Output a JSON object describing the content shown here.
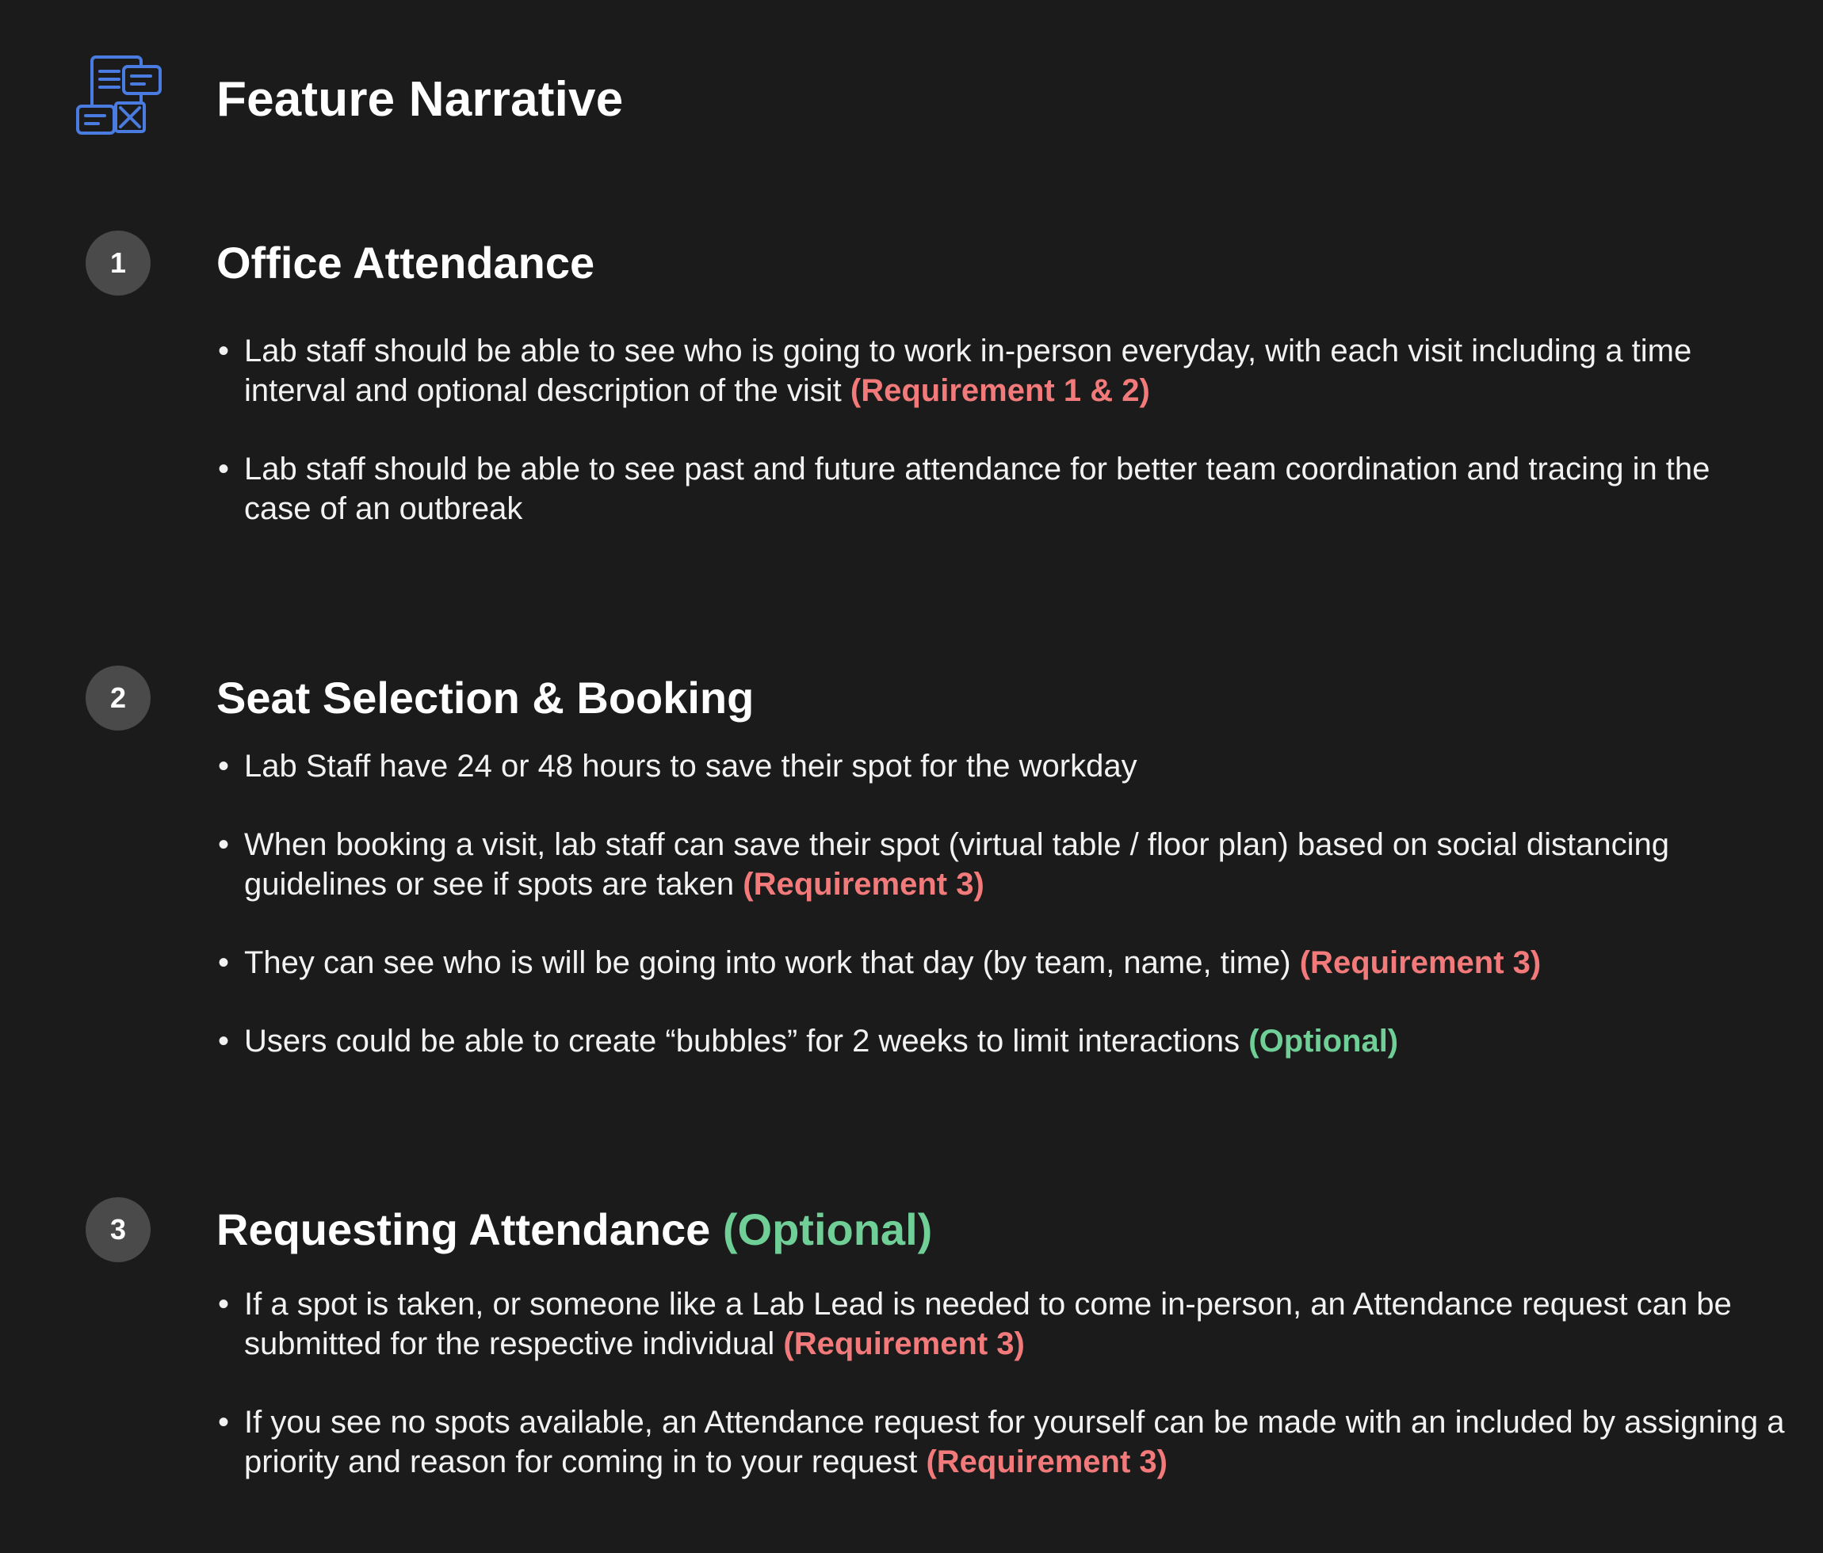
{
  "header": {
    "title": "Feature Narrative",
    "icon": "document-layout-icon",
    "icon_color": "#4a7be0"
  },
  "colors": {
    "background": "#1b1b1b",
    "badge": "#4a4a4a",
    "requirement": "#f27a7a",
    "optional": "#6fcf97"
  },
  "sections": [
    {
      "number": "1",
      "title": "Office Attendance",
      "title_tag": "",
      "bullets": [
        {
          "text": "Lab staff should be able to see who is going to work in-person everyday, with each visit including a time interval and optional description of the visit",
          "tag": "(Requirement 1 & 2)",
          "tag_type": "requirement"
        },
        {
          "text": "Lab staff should be able to see past and future attendance for better team coordination and tracing in the case of an outbreak",
          "tag": "",
          "tag_type": ""
        }
      ]
    },
    {
      "number": "2",
      "title": "Seat Selection & Booking",
      "title_tag": "",
      "bullets": [
        {
          "text": "Lab Staff have 24 or 48 hours to save their spot for the workday",
          "tag": "",
          "tag_type": ""
        },
        {
          "text": "When booking a visit, lab staff can save their spot (virtual table / floor plan) based on social distancing guidelines or see if spots are taken",
          "tag": "(Requirement 3)",
          "tag_type": "requirement"
        },
        {
          "text": "They can see who is will be going into work that day (by team, name, time)",
          "tag": "(Requirement 3)",
          "tag_type": "requirement"
        },
        {
          "text": "Users could be able to create “bubbles” for 2 weeks to limit interactions",
          "tag": "(Optional)",
          "tag_type": "optional"
        }
      ]
    },
    {
      "number": "3",
      "title": "Requesting Attendance",
      "title_tag": "(Optional)",
      "bullets": [
        {
          "text": "If a spot is taken, or someone like a Lab Lead is needed to come in-person, an Attendance request can be submitted for the respective individual",
          "tag": "(Requirement 3)",
          "tag_type": "requirement"
        },
        {
          "text": "If you see no spots available, an Attendance request for yourself can be made with an included by assigning a priority and reason for coming in to your request",
          "tag": "(Requirement 3)",
          "tag_type": "requirement"
        }
      ]
    }
  ]
}
